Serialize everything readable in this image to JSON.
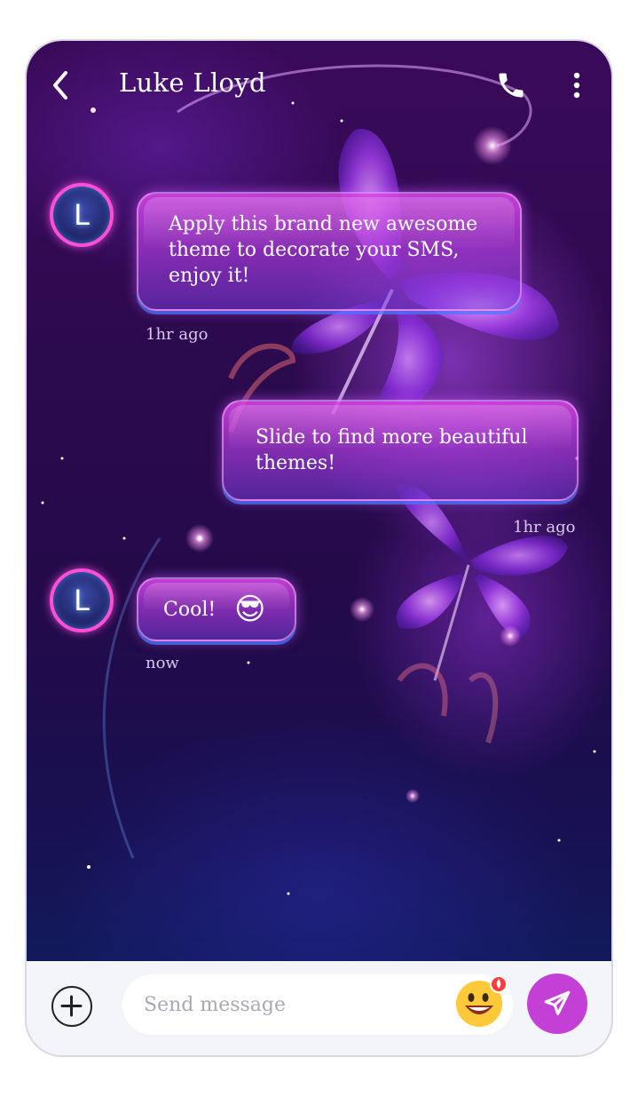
{
  "header": {
    "contact_name": "Luke Lloyd"
  },
  "messages": [
    {
      "sender": "incoming",
      "avatar_letter": "L",
      "text_lines": [
        "Apply this brand new awesome",
        "theme to decorate your SMS,",
        "enjoy it!"
      ],
      "time": "1hr ago"
    },
    {
      "sender": "outgoing",
      "text_lines": [
        "Slide to find more beautiful",
        "themes!"
      ],
      "time": "1hr ago"
    },
    {
      "sender": "incoming",
      "avatar_letter": "L",
      "text": "Cool!",
      "emoji": "😎",
      "time": "now"
    }
  ],
  "composer": {
    "placeholder": "Send message"
  },
  "icons": {
    "back": "chevron-left-icon",
    "call": "phone-icon",
    "more": "more-vertical-icon",
    "add": "plus-circle-icon",
    "emoji": "emoji-icon",
    "send": "send-icon"
  },
  "colors": {
    "accent": "#c43fd6",
    "avatar_ring": "#ff4fd8",
    "bubble": "#d646e6",
    "background_top": "#3a0a5a",
    "background_bottom": "#121a5c"
  }
}
